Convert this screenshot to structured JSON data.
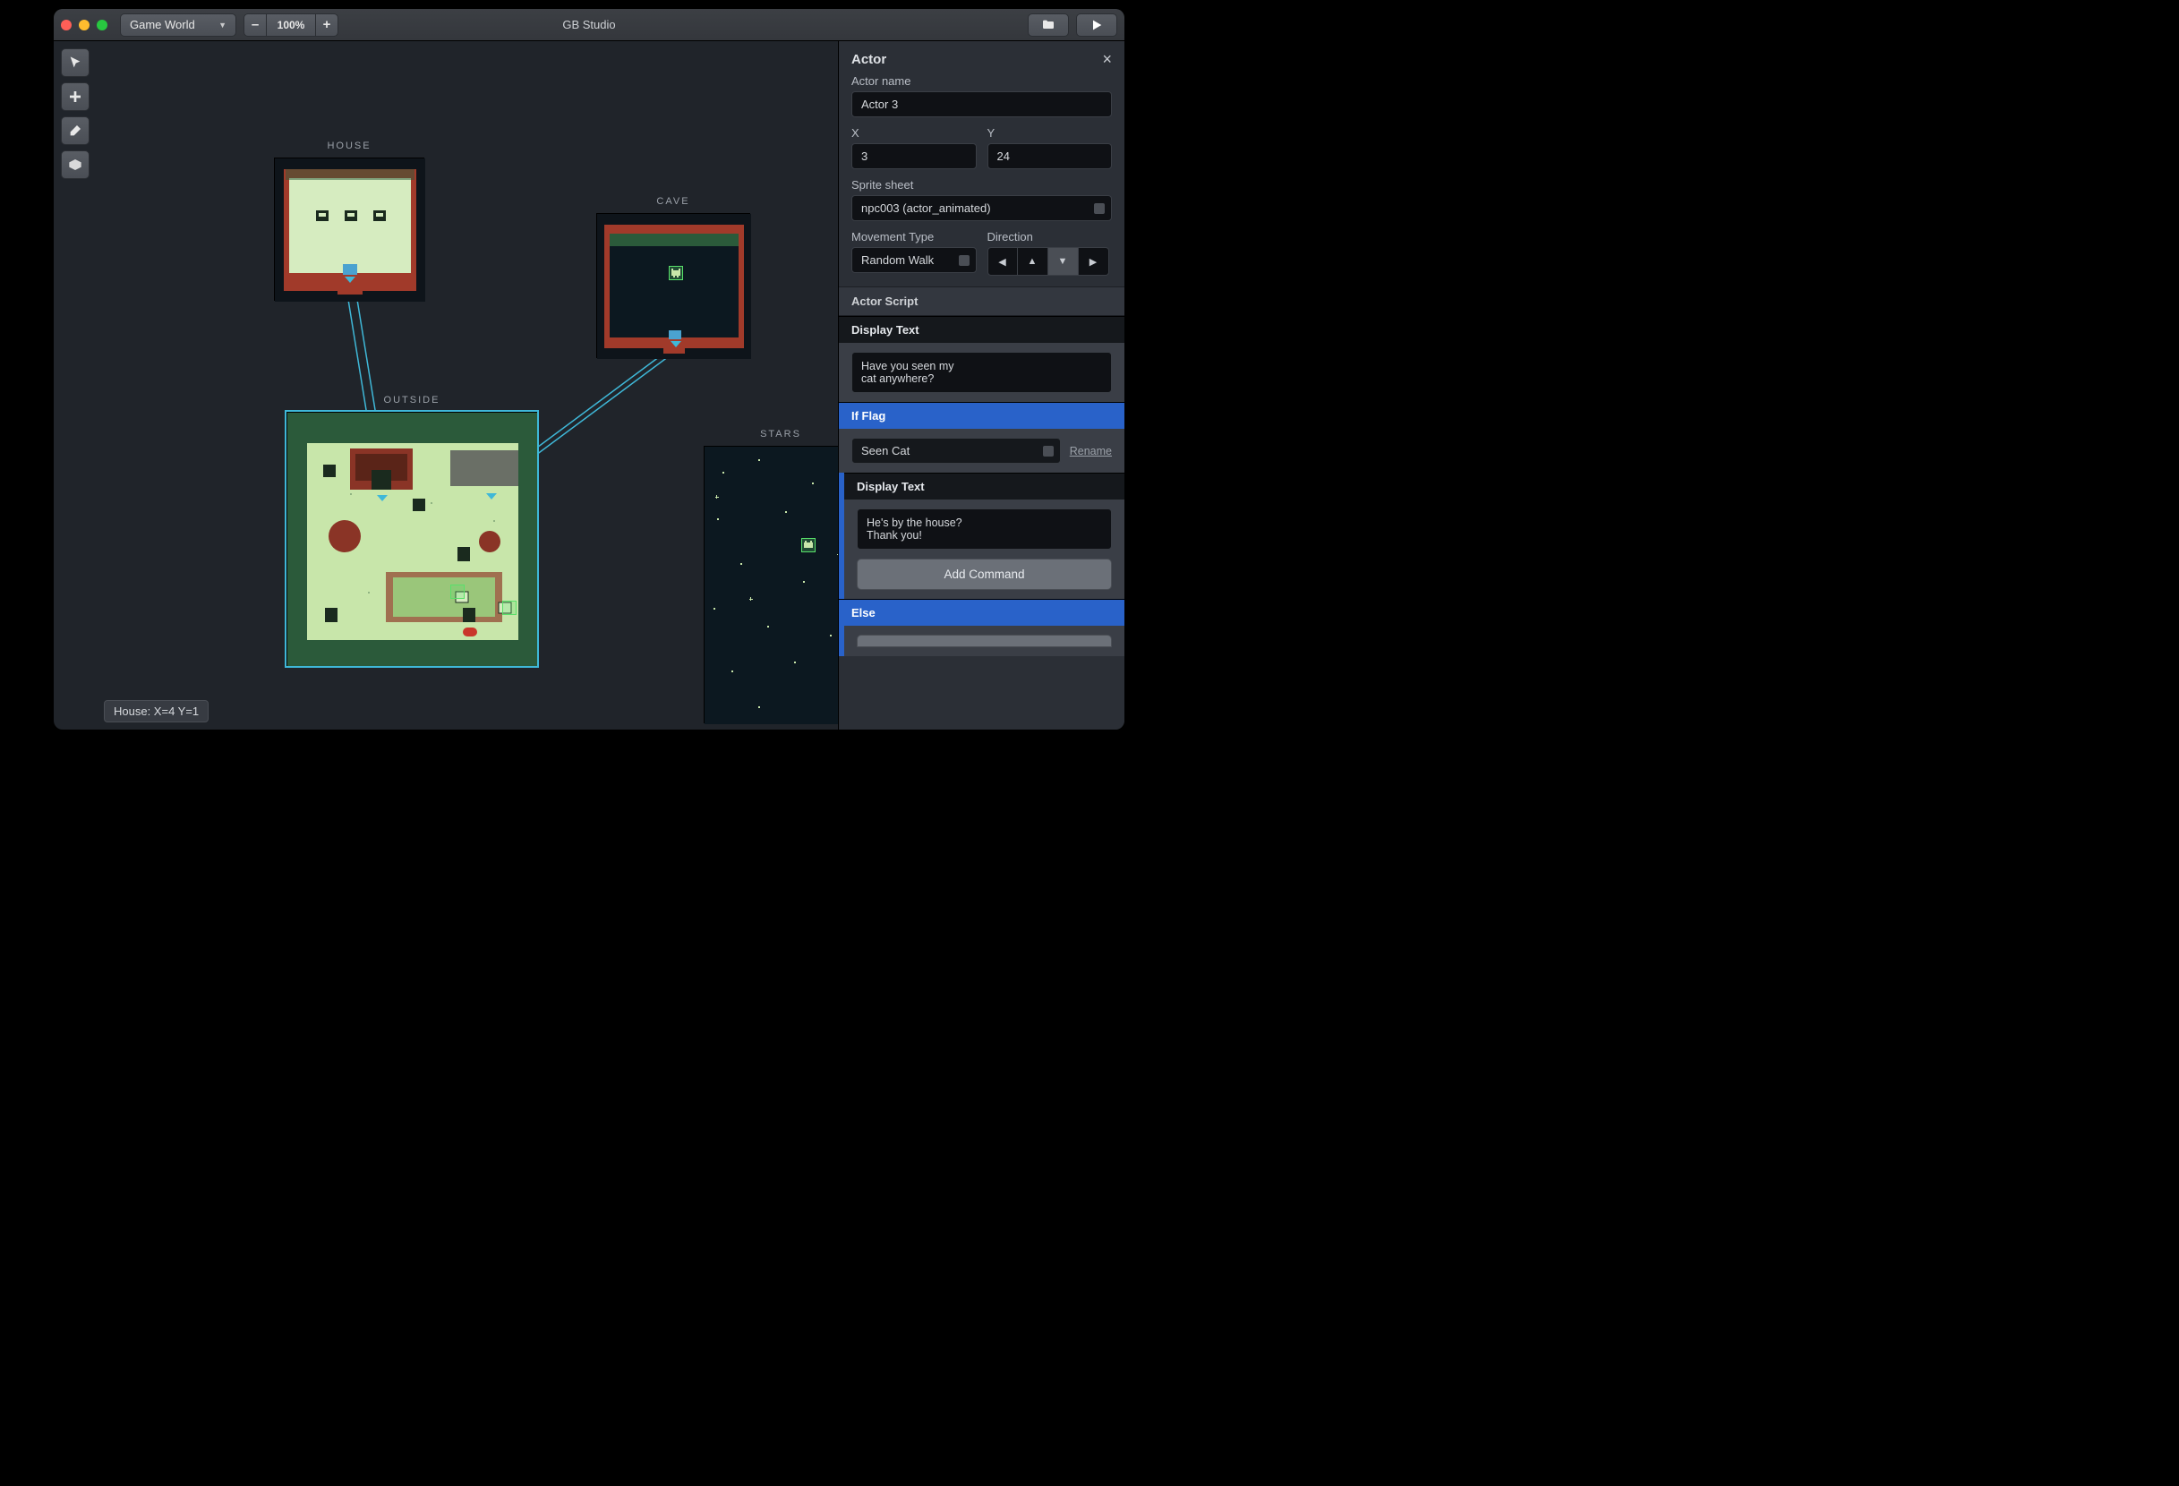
{
  "titlebar": {
    "mode": "Game World",
    "zoom_minus": "–",
    "zoom_value": "100%",
    "zoom_plus": "+",
    "app_title": "GB Studio"
  },
  "tools": [
    "select",
    "add",
    "erase",
    "brick"
  ],
  "scenes": {
    "house": "HOUSE",
    "cave": "CAVE",
    "outside": "OUTSIDE",
    "stars": "STARS"
  },
  "status": "House: X=4 Y=1",
  "inspector": {
    "title": "Actor",
    "close": "×",
    "name_label": "Actor name",
    "name_value": "Actor 3",
    "x_label": "X",
    "x_value": "3",
    "y_label": "Y",
    "y_value": "24",
    "sprite_label": "Sprite sheet",
    "sprite_value": "npc003 (actor_animated)",
    "move_label": "Movement Type",
    "move_value": "Random Walk",
    "dir_label": "Direction",
    "dir_selected": "down",
    "script_title": "Actor Script",
    "display_text_label": "Display Text",
    "text1": "Have you seen my\ncat anywhere?",
    "ifflag_label": "If Flag",
    "flag_value": "Seen Cat",
    "rename": "Rename",
    "text2": "He's by the house?\nThank you!",
    "add_command": "Add Command",
    "else_label": "Else"
  }
}
